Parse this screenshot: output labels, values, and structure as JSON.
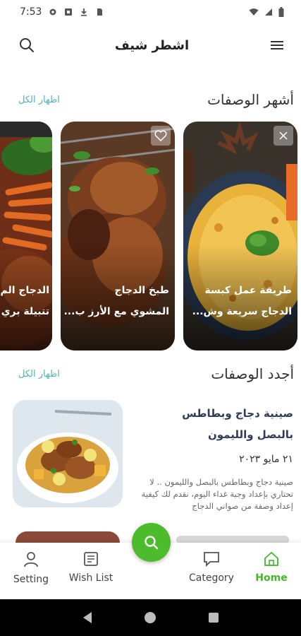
{
  "status_bar": {
    "time": "7:53",
    "left_icons": [
      "gear-icon",
      "shield-icon",
      "download-icon",
      "sim-icon"
    ],
    "right_icons": [
      "wifi-icon",
      "signal-icon",
      "battery-icon"
    ]
  },
  "app_bar": {
    "title": "اشطر شيف",
    "left_icon": "search-icon",
    "right_icon": "menu-icon"
  },
  "popular": {
    "title": "أشهر الوصفات",
    "show_all": "اظهار الكل",
    "cards": [
      {
        "line1": "طريقة عمل كبسة",
        "line2": "الدجاج سريعة وش..."
      },
      {
        "line1": "طبخ الدجاج",
        "line2": "المشوي مع الأرز ب..."
      },
      {
        "line1": "الدجاج الم",
        "line2": "تتبيلة بري"
      }
    ]
  },
  "latest": {
    "title": "أجدد  الوصفات",
    "show_all": "اظهار الكل",
    "items": [
      {
        "title": "صينية دجاج وبطاطس بالبصل والليمون",
        "date": "٢١ مايو ٢٠٢٣",
        "description": "صينية دجاج وبطاطس بالبصل والليمون .. لا تحتاري بإعداد وجبة غداء اليوم، نقدم لك كيفية إعداد وصفة من صواني الدجاج"
      }
    ]
  },
  "bottom_nav": {
    "items": [
      {
        "label": "Setting",
        "icon": "person-icon"
      },
      {
        "label": "Wish List",
        "icon": "newspaper-icon"
      },
      {
        "label": "Category",
        "icon": "chat-icon"
      },
      {
        "label": "Home",
        "icon": "home-icon",
        "active": true
      }
    ],
    "fab_icon": "search-icon"
  },
  "colors": {
    "accent_green": "#4cbc2c",
    "link_teal": "#4fb3b8",
    "title_navy": "#2f3b57"
  }
}
